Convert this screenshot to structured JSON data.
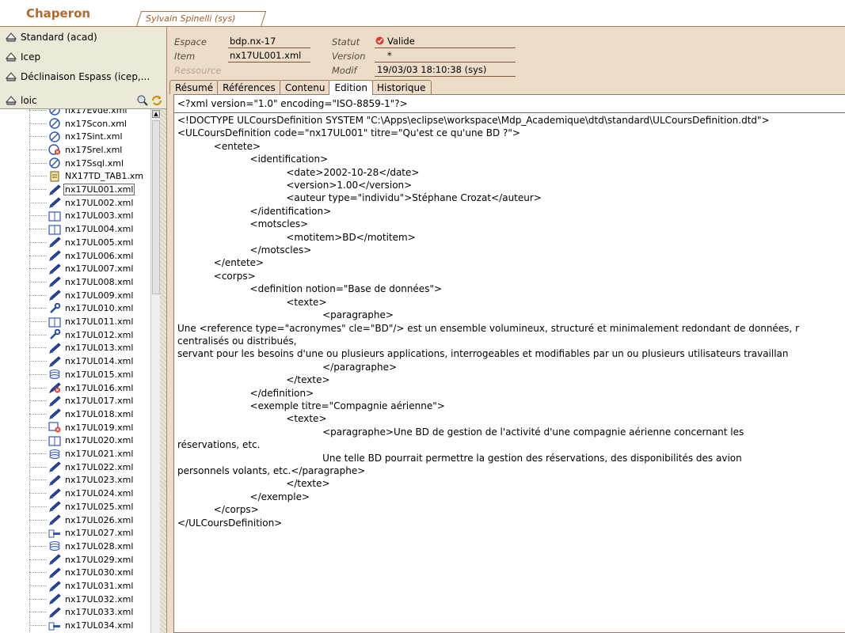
{
  "app": {
    "title": "Chaperon",
    "user_tab": "Sylvain Spinelli (sys)"
  },
  "sidebar": {
    "environments": [
      {
        "label": "Standard (acad)",
        "icon": "hat-icon"
      },
      {
        "label": "Icep",
        "icon": "hat-icon"
      },
      {
        "label": "Déclinaison Espass (icep,...",
        "icon": "hat-icon"
      }
    ],
    "tree_root": "loic",
    "tree_items": [
      {
        "label": "nx17Evde.xml",
        "icon": "circle-icon"
      },
      {
        "label": "nx17Scon.xml",
        "icon": "circle-icon"
      },
      {
        "label": "nx17Sint.xml",
        "icon": "circle-icon"
      },
      {
        "label": "nx17Srel.xml",
        "icon": "circle-error-icon"
      },
      {
        "label": "nx17Ssql.xml",
        "icon": "circle-icon"
      },
      {
        "label": "NX17TD_TAB1.xm",
        "icon": "document-icon"
      },
      {
        "label": "nx17UL001.xml",
        "icon": "pen-icon",
        "selected": true
      },
      {
        "label": "nx17UL002.xml",
        "icon": "pen-icon"
      },
      {
        "label": "nx17UL003.xml",
        "icon": "book-icon"
      },
      {
        "label": "nx17UL004.xml",
        "icon": "book-icon"
      },
      {
        "label": "nx17UL005.xml",
        "icon": "pen-icon"
      },
      {
        "label": "nx17UL006.xml",
        "icon": "pen-icon"
      },
      {
        "label": "nx17UL007.xml",
        "icon": "pen-icon"
      },
      {
        "label": "nx17UL008.xml",
        "icon": "pen-icon"
      },
      {
        "label": "nx17UL009.xml",
        "icon": "pen-icon"
      },
      {
        "label": "nx17UL010.xml",
        "icon": "wrench-icon"
      },
      {
        "label": "nx17UL011.xml",
        "icon": "book-icon"
      },
      {
        "label": "nx17UL012.xml",
        "icon": "wrench-icon"
      },
      {
        "label": "nx17UL013.xml",
        "icon": "pen-icon"
      },
      {
        "label": "nx17UL014.xml",
        "icon": "pen-icon"
      },
      {
        "label": "nx17UL015.xml",
        "icon": "stack-icon"
      },
      {
        "label": "nx17UL016.xml",
        "icon": "pen-error-icon"
      },
      {
        "label": "nx17UL017.xml",
        "icon": "pen-icon"
      },
      {
        "label": "nx17UL018.xml",
        "icon": "pen-icon"
      },
      {
        "label": "nx17UL019.xml",
        "icon": "book-error-icon"
      },
      {
        "label": "nx17UL020.xml",
        "icon": "book-icon"
      },
      {
        "label": "nx17UL021.xml",
        "icon": "stack-icon"
      },
      {
        "label": "nx17UL022.xml",
        "icon": "pen-icon"
      },
      {
        "label": "nx17UL023.xml",
        "icon": "pen-icon"
      },
      {
        "label": "nx17UL024.xml",
        "icon": "pen-icon"
      },
      {
        "label": "nx17UL025.xml",
        "icon": "pen-icon"
      },
      {
        "label": "nx17UL026.xml",
        "icon": "pen-icon"
      },
      {
        "label": "nx17UL027.xml",
        "icon": "pointer-icon"
      },
      {
        "label": "nx17UL028.xml",
        "icon": "stack-icon"
      },
      {
        "label": "nx17UL029.xml",
        "icon": "pen-icon"
      },
      {
        "label": "nx17UL030.xml",
        "icon": "pen-icon"
      },
      {
        "label": "nx17UL031.xml",
        "icon": "pen-icon"
      },
      {
        "label": "nx17UL032.xml",
        "icon": "pen-icon"
      },
      {
        "label": "nx17UL033.xml",
        "icon": "pen-icon"
      },
      {
        "label": "nx17UL034.xml",
        "icon": "pointer-icon"
      }
    ]
  },
  "meta": {
    "espace_label": "Espace",
    "espace_value": "bdp.nx-17",
    "item_label": "Item",
    "item_value": "nx17UL001.xml",
    "ressource_label": "Ressource",
    "statut_label": "Statut",
    "statut_value": "Valide",
    "version_label": "Version",
    "version_value": "*",
    "modif_label": "Modif",
    "modif_value": "19/03/03 18:10:38 (sys)"
  },
  "tabs": [
    {
      "label": "Résumé"
    },
    {
      "label": "Références"
    },
    {
      "label": "Contenu"
    },
    {
      "label": "Edition",
      "active": true
    },
    {
      "label": "Historique"
    }
  ],
  "editor": {
    "declaration": "<?xml version=\"1.0\" encoding=\"ISO-8859-1\"?>",
    "body": "<!DOCTYPE ULCoursDefinition SYSTEM \"C:\\Apps\\eclipse\\workspace\\Mdp_Academique\\dtd\\standard\\ULCoursDefinition.dtd\">\n<ULCoursDefinition code=\"nx17UL001\" titre=\"Qu'est ce qu'une BD ?\">\n            <entete>\n                        <identification>\n                                    <date>2002-10-28</date>\n                                    <version>1.00</version>\n                                    <auteur type=\"individu\">Stéphane Crozat</auteur>\n                        </identification>\n                        <motscles>\n                                    <motitem>BD</motitem>\n                        </motscles>\n            </entete>\n            <corps>\n                        <definition notion=\"Base de données\">\n                                    <texte>\n                                                <paragraphe>\nUne <reference type=\"acronymes\" cle=\"BD\"/> est un ensemble volumineux, structuré et minimalement redondant de données, r\ncentralisés ou distribués,\nservant pour les besoins d'une ou plusieurs applications, interrogeables et modifiables par un ou plusieurs utilisateurs travaillan\n                                                </paragraphe>\n                                    </texte>\n                        </definition>\n                        <exemple titre=\"Compagnie aérienne\">\n                                    <texte>\n                                                <paragraphe>Une BD de gestion de l'activité d'une compagnie aérienne concernant les\nréservations, etc.\n                                                Une telle BD pourrait permettre la gestion des réservations, des disponibilités des avion\npersonnels volants, etc.</paragraphe>\n                                    </texte>\n                        </exemple>\n            </corps>\n</ULCoursDefinition>"
  }
}
